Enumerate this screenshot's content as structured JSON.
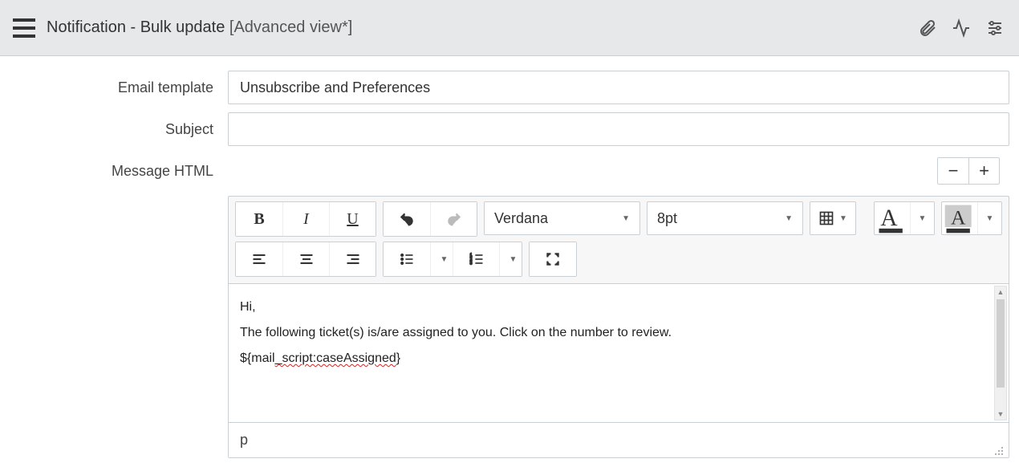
{
  "header": {
    "title_main": "Notification - Bulk update",
    "title_suffix": "[Advanced view*]"
  },
  "fields": {
    "email_template_label": "Email template",
    "email_template_value": "Unsubscribe and Preferences",
    "subject_label": "Subject",
    "subject_value": "",
    "message_html_label": "Message HTML"
  },
  "toolbar": {
    "font_family": "Verdana",
    "font_size": "8pt"
  },
  "editor_body": {
    "line1": "Hi,",
    "line2": "The following ticket(s) is/are assigned to you. Click on the number to review.",
    "line3_prefix": "${mail",
    "line3_err": "_script:caseAssigned",
    "line3_suffix": "}"
  },
  "status": {
    "path": "p"
  }
}
